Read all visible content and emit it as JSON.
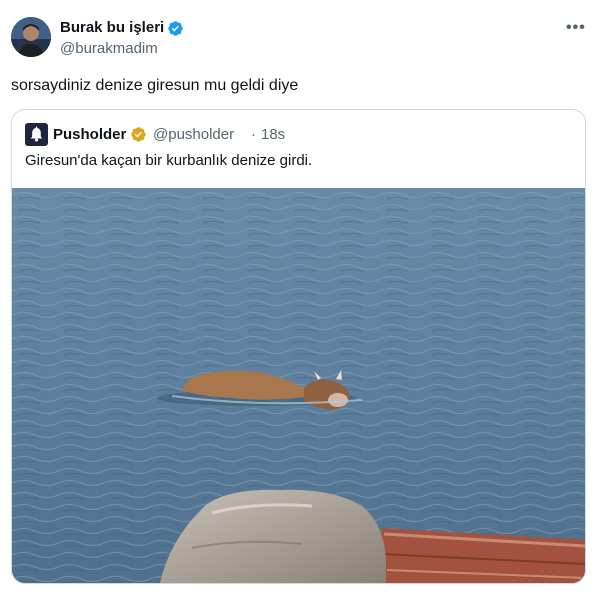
{
  "tweet": {
    "author_name": "Burak bu işleri",
    "author_handle": "@burakmadim",
    "more_label": "•••",
    "text": "sorsaydiniz denize giresun mu geldi diye"
  },
  "quote": {
    "author_name": "Pusholder",
    "author_handle": "@pusholder",
    "separator": "·",
    "time": "18s",
    "text": "Giresun'da kaçan bir kurbanlık denize girdi.",
    "image_alt": "Cow swimming in the sea"
  },
  "colors": {
    "verified_blue": "#1d9bf0",
    "verified_gold": "#d8a71e",
    "secondary_text": "#536471"
  },
  "icons": {
    "verified": "verified-badge-icon",
    "gold_verified": "gold-verified-badge-icon",
    "more": "more-icon",
    "bell": "bell-icon"
  }
}
